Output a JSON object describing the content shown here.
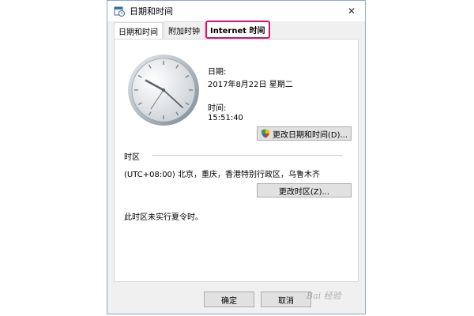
{
  "window": {
    "title": "日期和时间",
    "close_glyph": "✕"
  },
  "tabs": [
    {
      "label": "日期和时间",
      "active": true
    },
    {
      "label": "附加时钟",
      "active": false
    },
    {
      "label": "Internet 时间",
      "active": false,
      "highlighted": true
    }
  ],
  "date_section": {
    "date_label": "日期:",
    "date_value": "2017年8月22日 星期二",
    "time_label": "时间:",
    "time_value": "15:51:40",
    "change_datetime_button": "更改日期和时间(D)..."
  },
  "timezone_section": {
    "header": "时区",
    "value": "(UTC+08:00) 北京，重庆，香港特别行政区，乌鲁木齐",
    "change_timezone_button": "更改时区(Z)...",
    "dst_note": "此时区未实行夏令时。"
  },
  "footer": {
    "ok_button": "确定",
    "cancel_button": "取消",
    "watermark": "Bai 经验"
  },
  "colors": {
    "highlight_border": "#e0106a",
    "window_border": "#8aa8c9"
  },
  "icons": {
    "title": "calendar-clock-icon",
    "uac": "shield-icon",
    "close": "close-icon"
  }
}
